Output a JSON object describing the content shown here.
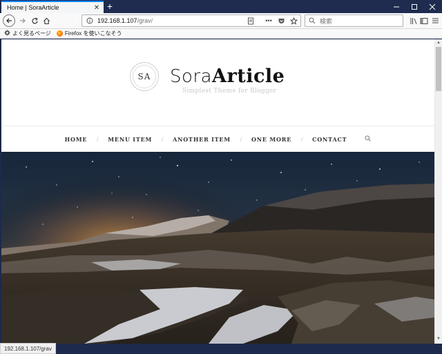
{
  "browser": {
    "tab_title": "Home | SoraArticle",
    "url_host": "192.168.1.107",
    "url_path": "/grav/",
    "search_placeholder": "検索",
    "status_text": "192.168.1.107/grav"
  },
  "bookmarks": [
    {
      "label": "よく見るページ",
      "icon": "gear-icon"
    },
    {
      "label": "Firefox を使いこなそう",
      "icon": "firefox-icon"
    }
  ],
  "site": {
    "logo_text": "SA",
    "name_light": "Sora",
    "name_bold": "Article",
    "tagline": "Simplest Theme for Blogger"
  },
  "menu": {
    "items": [
      "HOME",
      "MENU ITEM",
      "ANOTHER ITEM",
      "ONE MORE",
      "CONTACT"
    ],
    "separator": "/"
  }
}
